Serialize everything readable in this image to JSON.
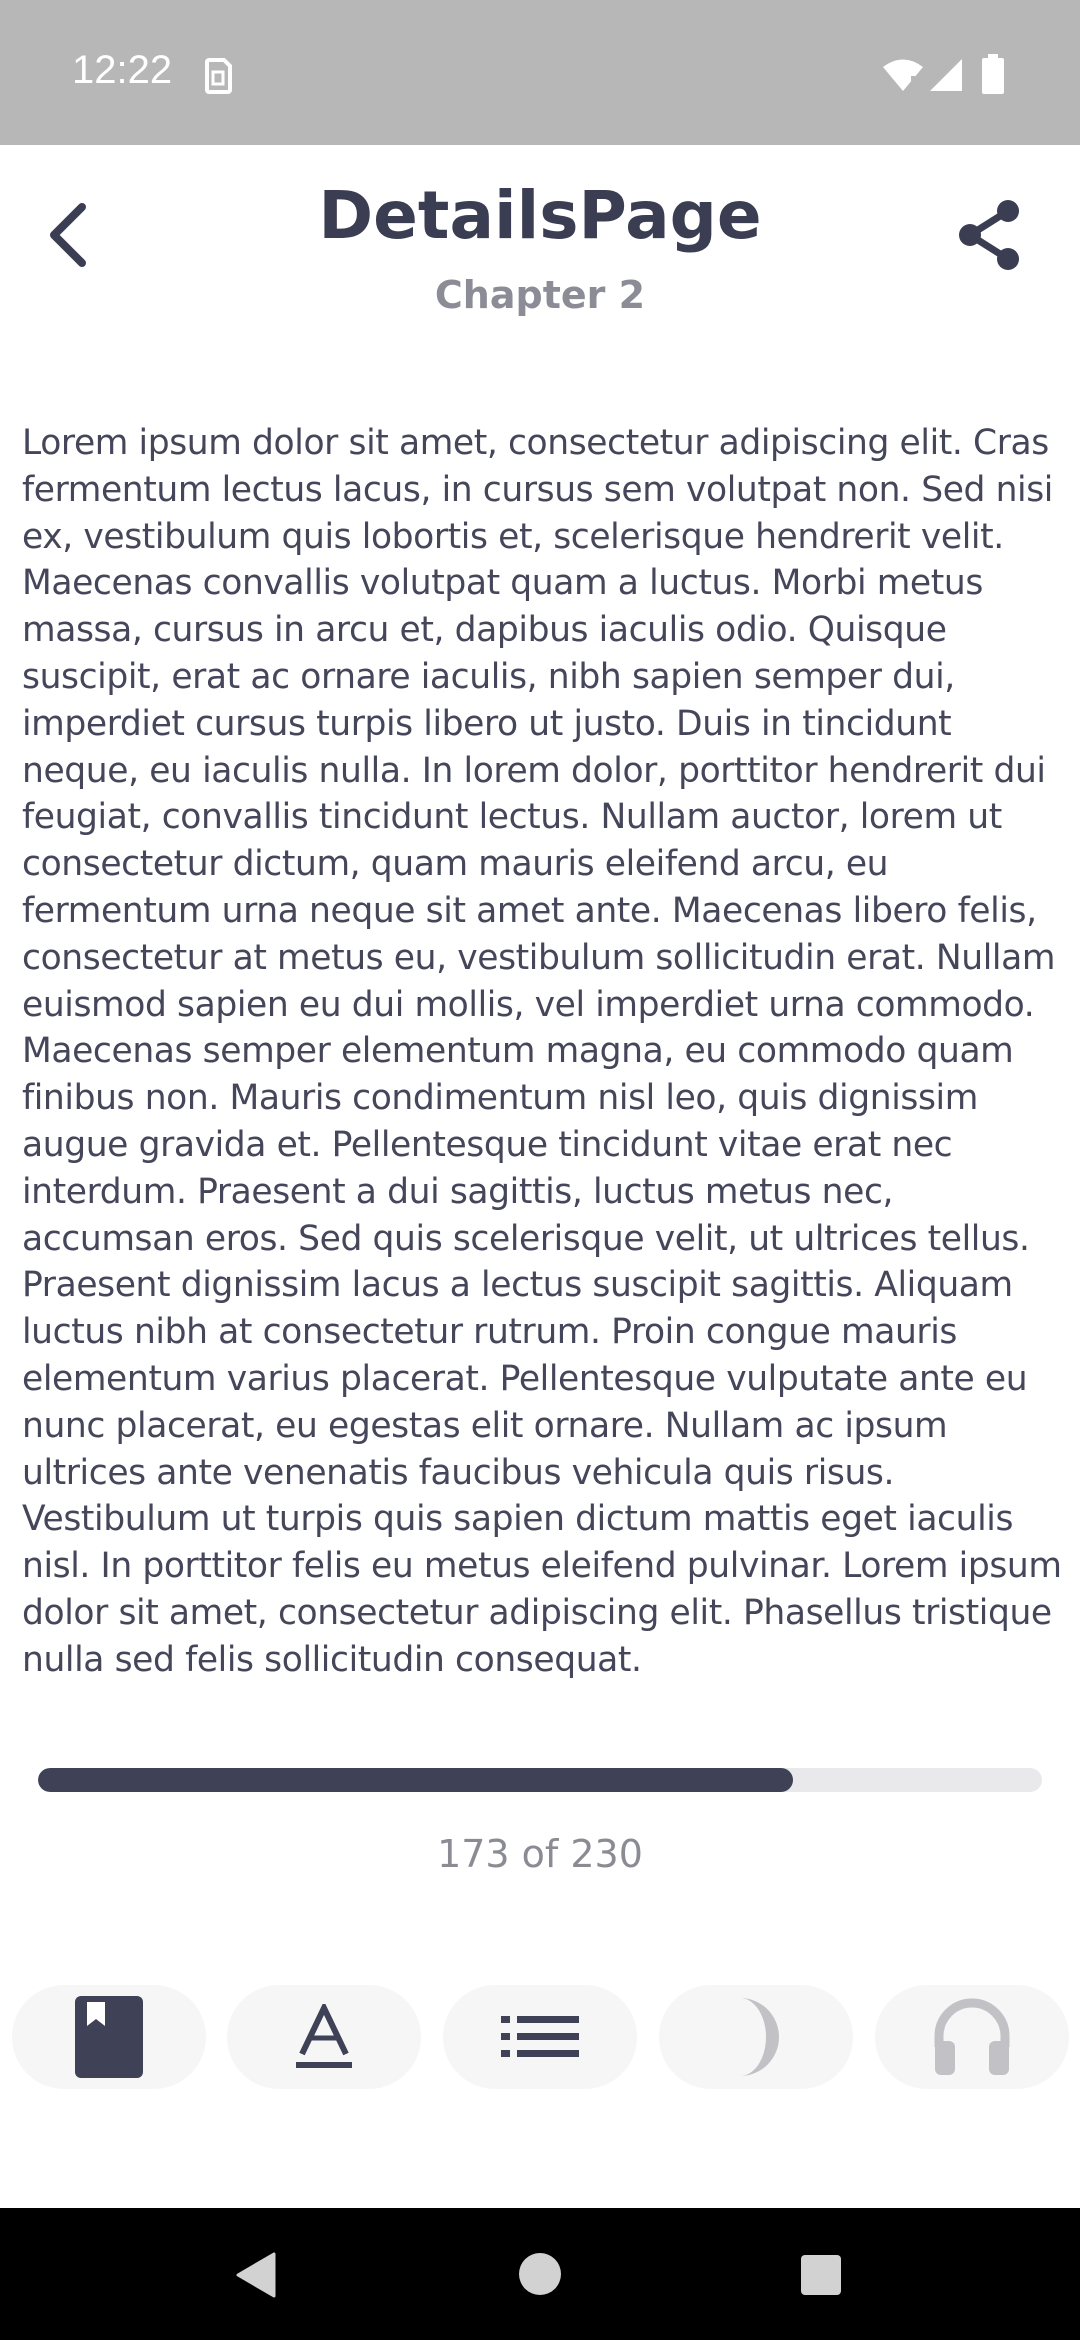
{
  "status_bar": {
    "time": "12:22",
    "icons": [
      "sim-card-icon",
      "wifi-icon",
      "signal-icon",
      "battery-icon"
    ]
  },
  "header": {
    "title": "DetailsPage",
    "subtitle": "Chapter 2",
    "back_icon": "chevron-left-icon",
    "share_icon": "share-icon"
  },
  "content": {
    "text": "Lorem ipsum dolor sit amet, consectetur adipiscing elit. Cras fermentum lectus lacus, in cursus sem volutpat non. Sed nisi ex, vestibulum quis lobortis et, scelerisque hendrerit velit. Maecenas convallis volutpat quam a luctus. Morbi metus massa, cursus in arcu et, dapibus iaculis odio. Quisque suscipit, erat ac ornare iaculis, nibh sapien semper dui, imperdiet cursus turpis libero ut justo. Duis in tincidunt neque, eu iaculis nulla. In lorem dolor, porttitor hendrerit dui feugiat, convallis tincidunt lectus. Nullam auctor, lorem ut consectetur dictum, quam mauris eleifend arcu, eu fermentum urna neque sit amet ante. Maecenas libero felis, consectetur at metus eu, vestibulum sollicitudin erat. Nullam euismod sapien eu dui mollis, vel imperdiet urna commodo. Maecenas semper elementum magna, eu commodo quam finibus non. Mauris condimentum nisl leo, quis dignissim augue gravida et. Pellentesque tincidunt vitae erat nec interdum. Praesent a dui sagittis, luctus metus nec, accumsan eros. Sed quis scelerisque velit, ut ultrices tellus. Praesent dignissim lacus a lectus suscipit sagittis. Aliquam luctus nibh at consectetur rutrum. Proin congue mauris elementum varius placerat. Pellentesque vulputate ante eu nunc placerat, eu egestas elit ornare. Nullam ac ipsum ultrices ante venenatis faucibus vehicula quis risus. Vestibulum ut turpis quis sapien dictum mattis eget iaculis nisl. In porttitor felis eu metus eleifend pulvinar. Lorem ipsum dolor sit amet, consectetur adipiscing elit. Phasellus tristique nulla sed felis sollicitudin consequat."
  },
  "progress": {
    "current": 173,
    "total": 230,
    "label": "173 of 230"
  },
  "toolbar": {
    "buttons": [
      {
        "icon": "bookmark-book-icon",
        "active": true
      },
      {
        "icon": "font-style-icon",
        "active": true
      },
      {
        "icon": "list-icon",
        "active": true
      },
      {
        "icon": "night-mode-icon",
        "active": false
      },
      {
        "icon": "headphones-icon",
        "active": false
      }
    ]
  },
  "nav_bar": {
    "icons": [
      "back-triangle-icon",
      "home-circle-icon",
      "recents-square-icon"
    ]
  },
  "colors": {
    "primary": "#3f4156",
    "muted": "#8c8c96",
    "disabled": "#c2c2c6",
    "status_bar": "#b7b7b7",
    "progress_track": "#e9e9ec"
  }
}
